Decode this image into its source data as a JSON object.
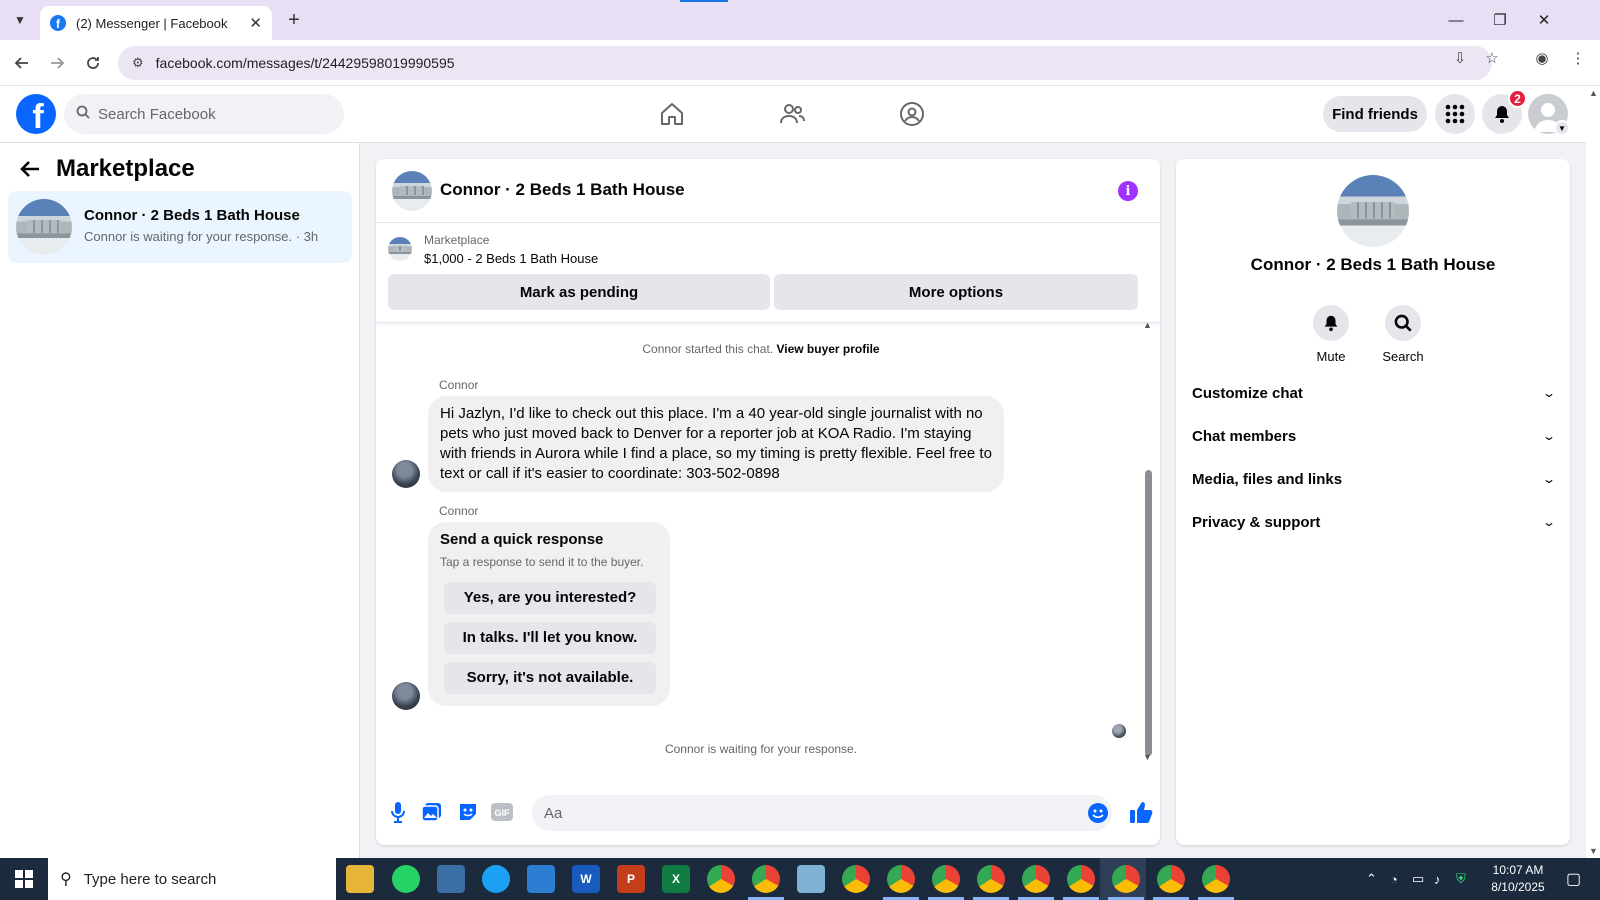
{
  "browser": {
    "tab_title": "(2) Messenger | Facebook",
    "url": "facebook.com/messages/t/24429598019990595"
  },
  "header": {
    "search_placeholder": "Search Facebook",
    "find_friends_label": "Find friends",
    "notification_count": "2"
  },
  "sidebar": {
    "title": "Marketplace",
    "conversations": [
      {
        "name": "Connor · 2 Beds 1 Bath House",
        "preview": "Connor is waiting for your response. · 3h"
      }
    ]
  },
  "chat": {
    "title": "Connor · 2 Beds 1 Bath House",
    "listing": {
      "category": "Marketplace",
      "price_title": "$1,000 - 2 Beds 1 Bath House",
      "mark_pending_label": "Mark as pending",
      "more_options_label": "More options"
    },
    "started_text": "Connor started this chat.",
    "view_profile_label": "View buyer profile",
    "messages": [
      {
        "sender": "Connor",
        "text": "Hi Jazlyn, I'd like to check out this place. I'm a 40 year-old single journalist with no pets who just moved back to Denver for a reporter job at KOA Radio. I'm staying with friends in Aurora while I find a place, so my timing is pretty flexible. Feel free to text or call if it's easier to coordinate: 303-502-0898"
      }
    ],
    "quick_response": {
      "sender": "Connor",
      "title": "Send a quick response",
      "subtitle": "Tap a response to send it to the buyer.",
      "options": [
        "Yes, are you interested?",
        "In talks. I'll let you know.",
        "Sorry, it's not available."
      ]
    },
    "waiting_text": "Connor is waiting for your response.",
    "composer_placeholder": "Aa"
  },
  "info_panel": {
    "name": "Connor · 2 Beds 1 Bath House",
    "actions": [
      "Mute",
      "Search"
    ],
    "sections": [
      "Customize chat",
      "Chat members",
      "Media, files and links",
      "Privacy & support"
    ]
  },
  "taskbar": {
    "search_placeholder": "Type here to search",
    "time": "10:07 AM",
    "date": "8/10/2025"
  },
  "colors": {
    "facebook_blue": "#0866ff",
    "selected_conversation_bg": "#ebf5ff",
    "info_icon": "#a033ff",
    "notification_badge": "#e41e3f",
    "taskbar": "#1c2a3e"
  }
}
